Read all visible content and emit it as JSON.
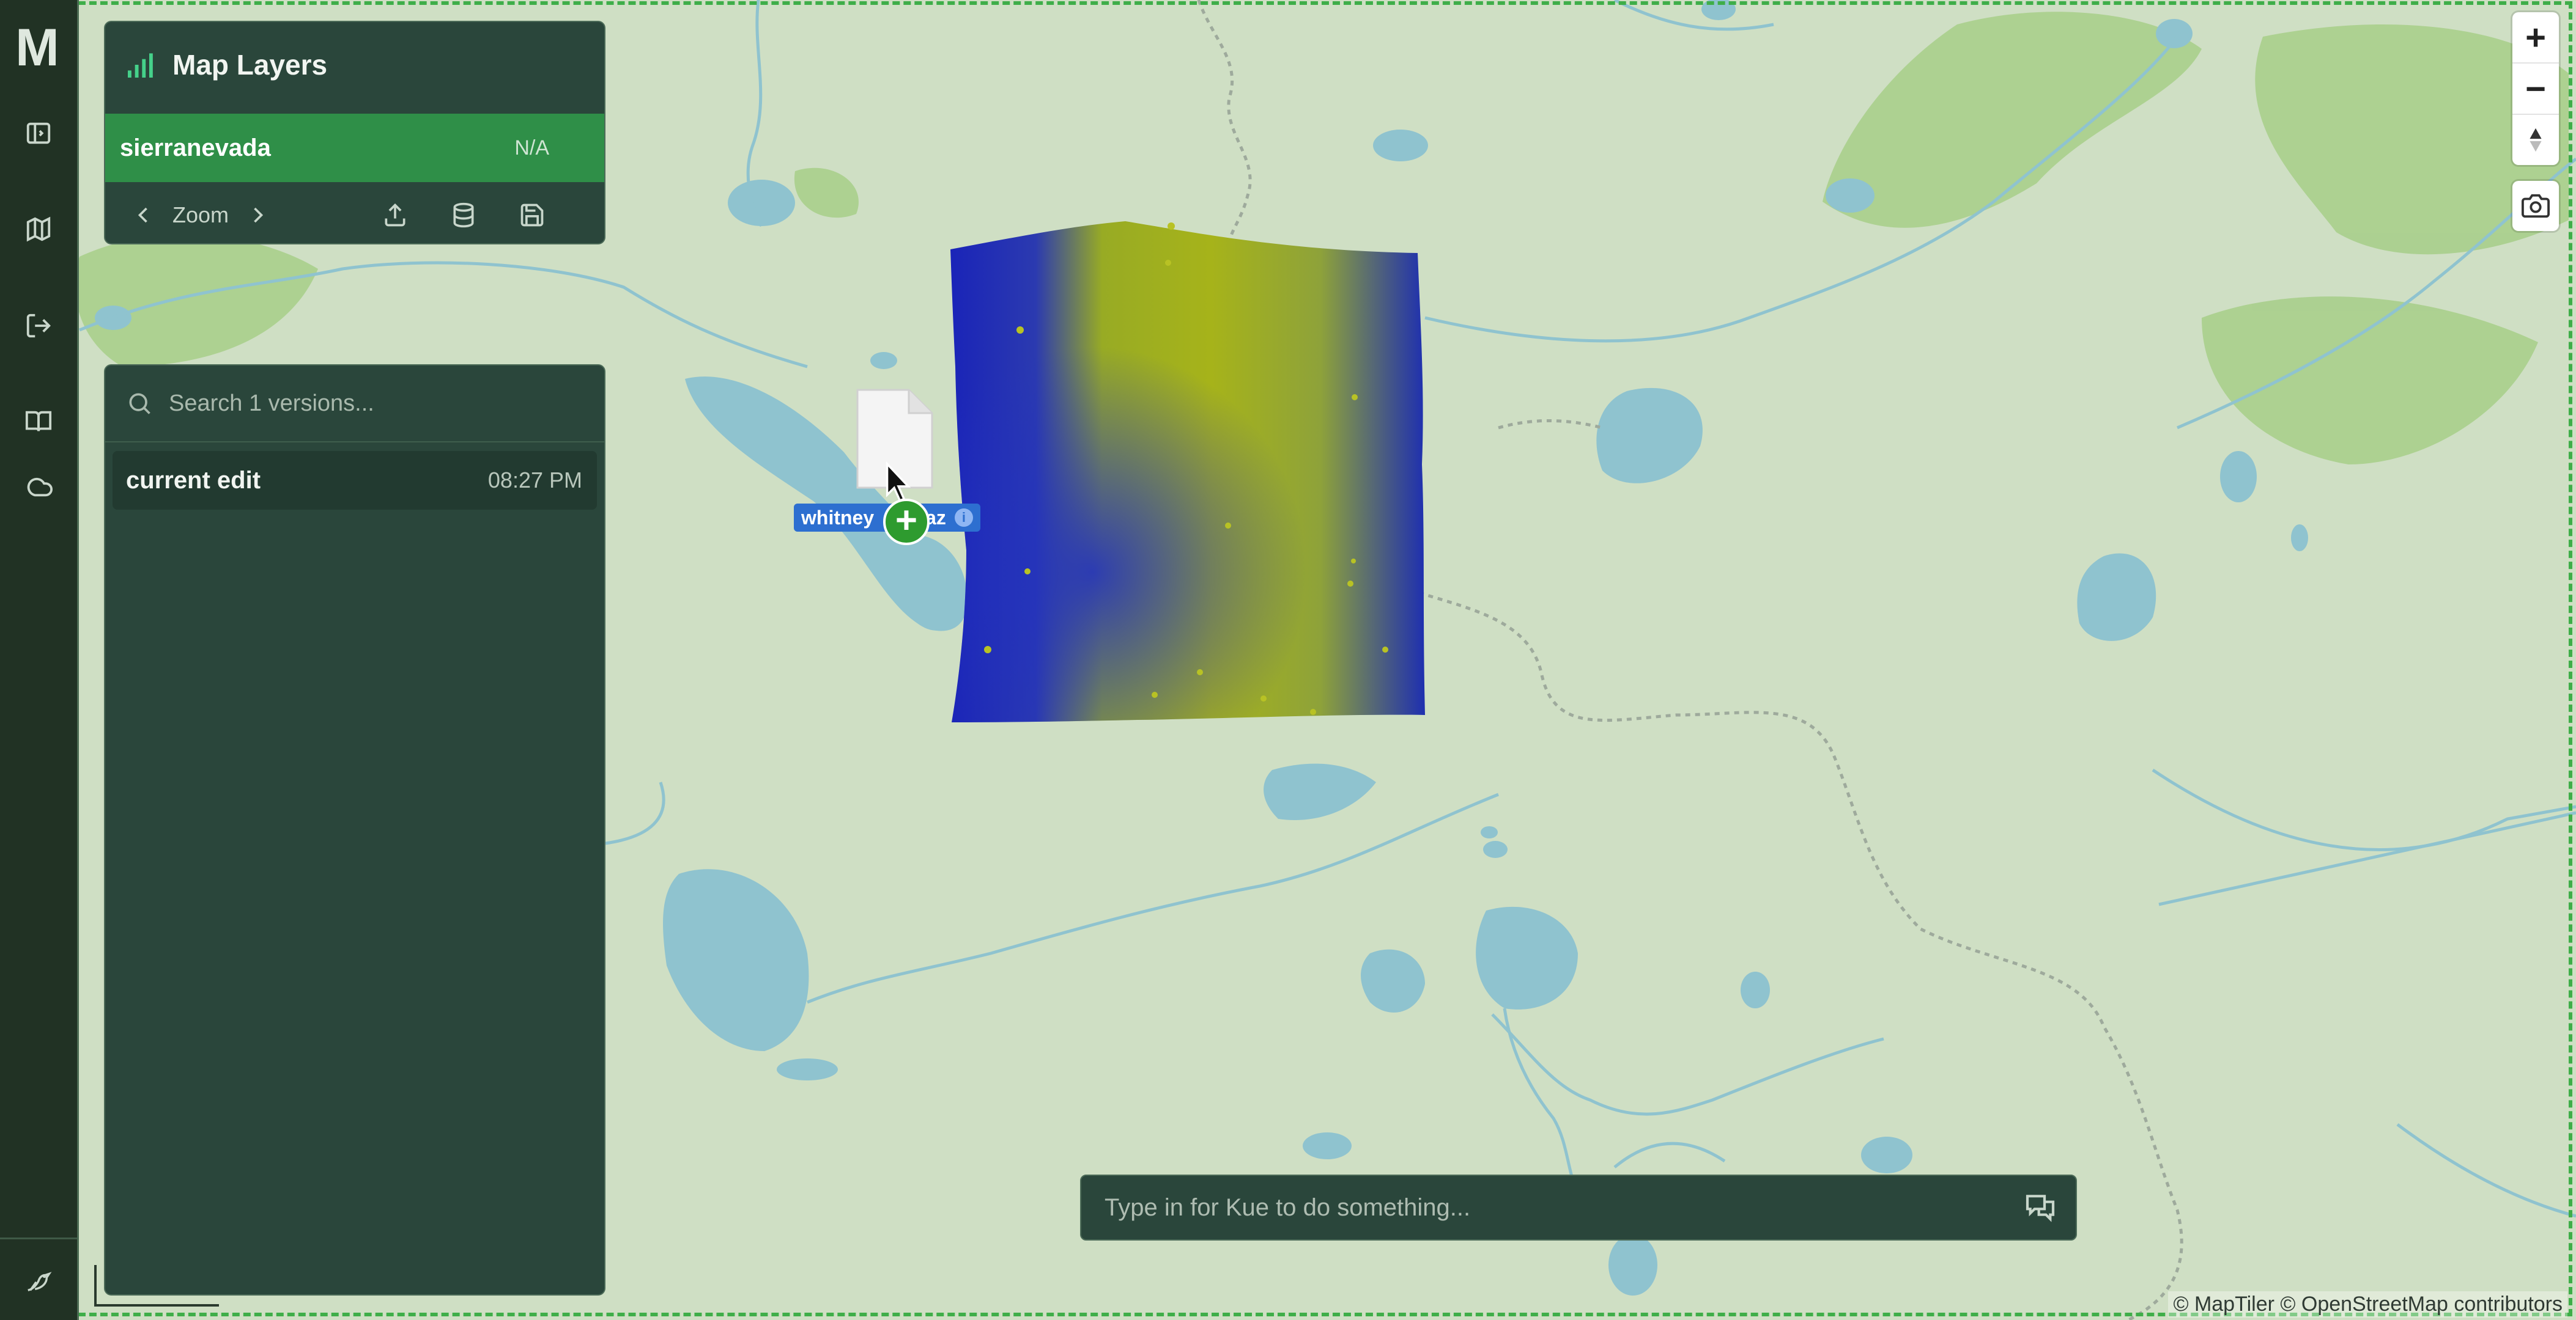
{
  "rail": {
    "logo": "M",
    "items": [
      {
        "icon": "sidebar-toggle-icon"
      },
      {
        "icon": "map-icon"
      },
      {
        "icon": "logout-icon"
      },
      {
        "icon": "book-icon"
      },
      {
        "icon": "cloud-icon"
      }
    ],
    "bottom_icon": "bird-icon"
  },
  "layers_panel": {
    "title": "Map Layers",
    "title_icon": "signal-bars-icon",
    "layer": {
      "name": "sierranevada",
      "status": "N/A"
    },
    "tools": {
      "prev": "chevron-left-icon",
      "zoom_label": "Zoom",
      "next": "chevron-right-icon",
      "upload": "upload-icon",
      "database": "database-icon",
      "save": "save-icon"
    }
  },
  "versions_panel": {
    "search_placeholder": "Search 1 versions...",
    "items": [
      {
        "name": "current edit",
        "time": "08:27 PM"
      }
    ]
  },
  "map_controls": {
    "zoom_in": "+",
    "zoom_out": "−",
    "compass": "compass-icon",
    "screenshot": "camera-icon"
  },
  "chat": {
    "placeholder": "Type in for Kue to do something...",
    "icon": "message-icon"
  },
  "drag": {
    "label": "whitney",
    "label_suffix": "az",
    "badge": "+"
  },
  "attribution": "© MapTiler © OpenStreetMap contributors",
  "colors": {
    "map_bg": "#cfdfc4",
    "water": "#8fc3cf",
    "forest": "#a9cf8c",
    "panel": "#2a463b",
    "accent_green": "#2f8f48",
    "raster_low": "#1a24b8",
    "raster_high": "#a3b21c"
  }
}
